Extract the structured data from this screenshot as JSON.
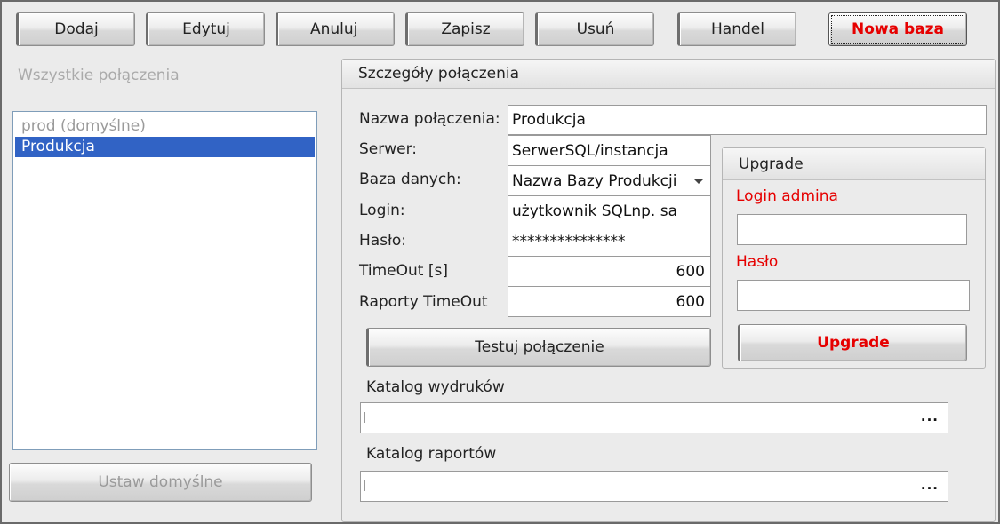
{
  "toolbar": {
    "add_label": "Dodaj",
    "edit_label": "Edytuj",
    "cancel_label": "Anuluj",
    "save_label": "Zapisz",
    "delete_label": "Usuń",
    "trade_label": "Handel",
    "new_db_label": "Nowa baza"
  },
  "left_panel": {
    "title": "Wszystkie połączenia",
    "connections": [
      "prod (domyślne)",
      "Produkcja"
    ],
    "selected_index": 1,
    "set_default_label": "Ustaw domyślne"
  },
  "details": {
    "title": "Szczegóły połączenia",
    "connection_name_label": "Nazwa połączenia:",
    "connection_name_value": "Produkcja",
    "server_label": "Serwer:",
    "server_value": "SerwerSQL/instancja",
    "database_label": "Baza danych:",
    "database_value": "Nazwa Bazy Produkcji",
    "login_label": "Login:",
    "login_value": "użytkownik SQLnp. sa",
    "password_label": "Hasło:",
    "password_value": "***************",
    "timeout_label": "TimeOut [s]",
    "timeout_value": "600",
    "report_timeout_label": "Raporty TimeOut",
    "report_timeout_value": "600",
    "test_label": "Testuj połączenie",
    "print_catalog_label": "Katalog wydruków",
    "print_catalog_value": "",
    "report_catalog_label": "Katalog raportów",
    "report_catalog_value": "",
    "browse_label": "..."
  },
  "upgrade": {
    "title": "Upgrade",
    "admin_login_label": "Login admina",
    "admin_login_value": "",
    "password_label": "Hasło",
    "password_value": "",
    "button_label": "Upgrade"
  },
  "colors": {
    "accent_red": "#e60000",
    "selection_blue": "#3163c5"
  }
}
